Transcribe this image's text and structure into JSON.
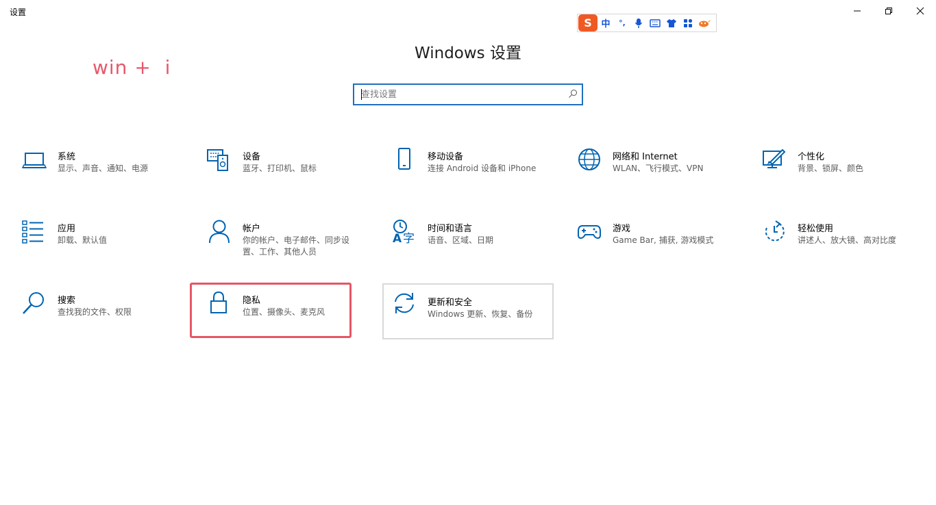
{
  "window": {
    "title": "设置",
    "controls": [
      "minimize",
      "maximize",
      "close"
    ]
  },
  "ime_toolbar": {
    "logo": "S",
    "mode": "中",
    "punct": "°,",
    "items": [
      "microphone-icon",
      "keyboard-icon",
      "shirt-icon",
      "apps-icon",
      "pet-icon"
    ]
  },
  "annotation": "win +  i",
  "header": {
    "title": "Windows 设置"
  },
  "search": {
    "placeholder": "查找设置",
    "value": ""
  },
  "tiles": [
    {
      "title": "系统",
      "desc": "显示、声音、通知、电源",
      "icon": "laptop-icon"
    },
    {
      "title": "设备",
      "desc": "蓝牙、打印机、鼠标",
      "icon": "devices-icon"
    },
    {
      "title": "移动设备",
      "desc": "连接 Android 设备和 iPhone",
      "icon": "phone-icon"
    },
    {
      "title": "网络和 Internet",
      "desc": "WLAN、飞行模式、VPN",
      "icon": "globe-icon"
    },
    {
      "title": "个性化",
      "desc": "背景、锁屏、颜色",
      "icon": "personalize-icon"
    },
    {
      "title": "应用",
      "desc": "卸载、默认值",
      "icon": "apps-list-icon"
    },
    {
      "title": "帐户",
      "desc": "你的帐户、电子邮件、同步设置、工作、其他人员",
      "icon": "person-icon"
    },
    {
      "title": "时间和语言",
      "desc": "语音、区域、日期",
      "icon": "time-language-icon"
    },
    {
      "title": "游戏",
      "desc": "Game Bar, 捕获, 游戏模式",
      "icon": "gamepad-icon"
    },
    {
      "title": "轻松使用",
      "desc": "讲述人、放大镜、高对比度",
      "icon": "ease-of-access-icon"
    },
    {
      "title": "搜索",
      "desc": "查找我的文件、权限",
      "icon": "search-icon"
    },
    {
      "title": "隐私",
      "desc": "位置、摄像头、麦克风",
      "icon": "lock-icon"
    },
    {
      "title": "更新和安全",
      "desc": "Windows 更新、恢复、备份",
      "icon": "update-icon"
    }
  ],
  "colors": {
    "accent": "#0063b1",
    "highlight": "#e65565",
    "annotation": "#e8576a"
  }
}
